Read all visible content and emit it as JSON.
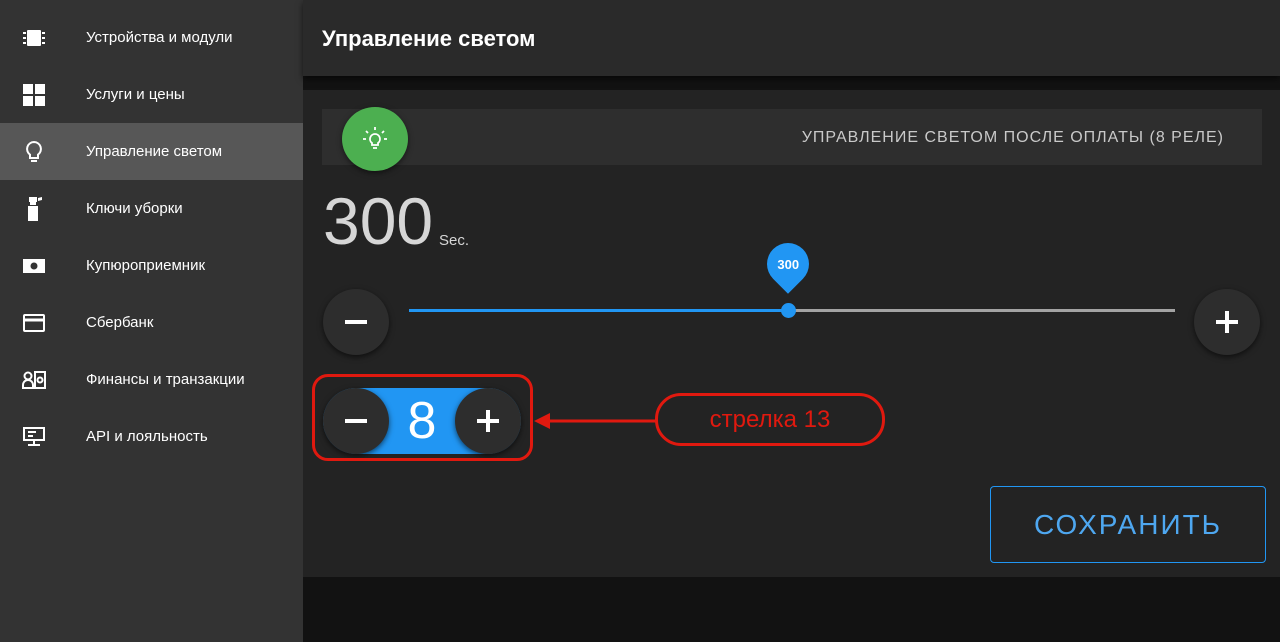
{
  "sidebar": {
    "items": [
      {
        "label": "Устройства и модули",
        "icon": "chip-icon"
      },
      {
        "label": "Услуги и цены",
        "icon": "grid-icon"
      },
      {
        "label": "Управление светом",
        "icon": "lightbulb-icon",
        "active": true
      },
      {
        "label": "Ключи уборки",
        "icon": "spray-bottle-icon"
      },
      {
        "label": "Купюроприемник",
        "icon": "banknote-icon"
      },
      {
        "label": "Сбербанк",
        "icon": "credit-card-icon"
      },
      {
        "label": "Финансы и транзакции",
        "icon": "finance-icon"
      },
      {
        "label": "API и лояльность",
        "icon": "monitor-icon"
      }
    ]
  },
  "header": {
    "title": "Управление светом"
  },
  "card": {
    "strip_title": "УПРАВЛЕНИЕ СВЕТОМ ПОСЛЕ ОПЛАТЫ (8 РЕЛЕ)",
    "time_value": "300",
    "time_unit": "Sec.",
    "slider": {
      "value": "300",
      "fraction": 0.495
    },
    "stepper_value": "8",
    "save_label": "СОХРАНИТЬ"
  },
  "annotation": {
    "label": "стрелка 13"
  },
  "colors": {
    "accent": "#2196f3",
    "bulb": "#4caf50",
    "annotation": "#e0190f"
  }
}
